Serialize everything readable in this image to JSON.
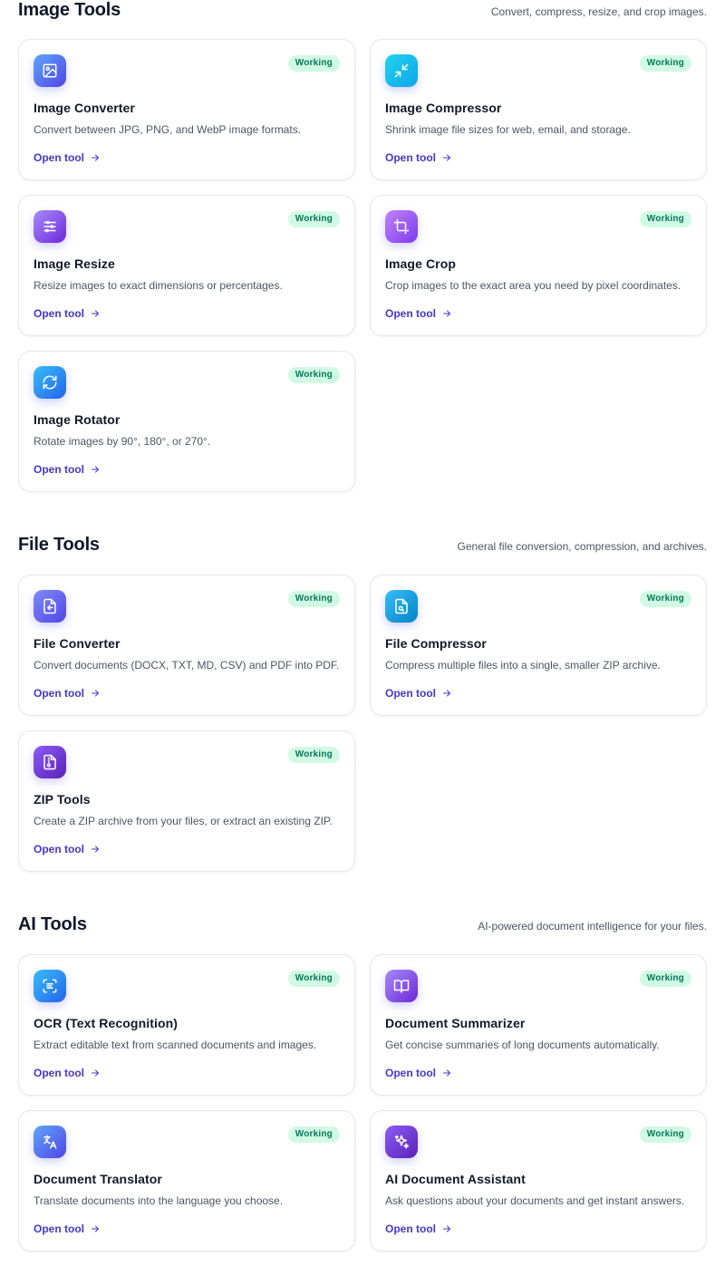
{
  "sections": [
    {
      "title": "Image Tools",
      "description": "Convert, compress, resize, and crop images.",
      "cards": [
        {
          "title": "Image Converter",
          "description": "Convert between JPG, PNG, and WebP image formats.",
          "badge": "Working",
          "link": "Open tool",
          "icon": "image-icon"
        },
        {
          "title": "Image Compressor",
          "description": "Shrink image file sizes for web, email, and storage.",
          "badge": "Working",
          "link": "Open tool",
          "icon": "minimize-icon"
        },
        {
          "title": "Image Resize",
          "description": "Resize images to exact dimensions or percentages.",
          "badge": "Working",
          "link": "Open tool",
          "icon": "sliders-icon"
        },
        {
          "title": "Image Crop",
          "description": "Crop images to the exact area you need by pixel coordinates.",
          "badge": "Working",
          "link": "Open tool",
          "icon": "crop-icon"
        },
        {
          "title": "Image Rotator",
          "description": "Rotate images by 90°, 180°, or 270°.",
          "badge": "Working",
          "link": "Open tool",
          "icon": "rotate-icon"
        }
      ]
    },
    {
      "title": "File Tools",
      "description": "General file conversion, compression, and archives.",
      "cards": [
        {
          "title": "File Converter",
          "description": "Convert documents (DOCX, TXT, MD, CSV) and PDF into PDF.",
          "badge": "Working",
          "link": "Open tool",
          "icon": "file-convert-icon"
        },
        {
          "title": "File Compressor",
          "description": "Compress multiple files into a single, smaller ZIP archive.",
          "badge": "Working",
          "link": "Open tool",
          "icon": "file-compress-icon"
        },
        {
          "title": "ZIP Tools",
          "description": "Create a ZIP archive from your files, or extract an existing ZIP.",
          "badge": "Working",
          "link": "Open tool",
          "icon": "file-archive-icon"
        }
      ]
    },
    {
      "title": "AI Tools",
      "description": "AI-powered document intelligence for your files.",
      "cards": [
        {
          "title": "OCR (Text Recognition)",
          "description": "Extract editable text from scanned documents and images.",
          "badge": "Working",
          "link": "Open tool",
          "icon": "scan-text-icon"
        },
        {
          "title": "Document Summarizer",
          "description": "Get concise summaries of long documents automatically.",
          "badge": "Working",
          "link": "Open tool",
          "icon": "book-open-icon"
        },
        {
          "title": "Document Translator",
          "description": "Translate documents into the language you choose.",
          "badge": "Working",
          "link": "Open tool",
          "icon": "languages-icon"
        },
        {
          "title": "AI Document Assistant",
          "description": "Ask questions about your documents and get instant answers.",
          "badge": "Working",
          "link": "Open tool",
          "icon": "sparkles-icon"
        }
      ]
    }
  ]
}
